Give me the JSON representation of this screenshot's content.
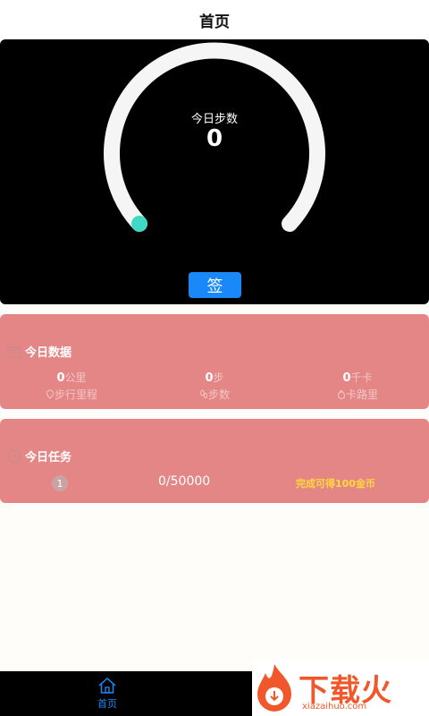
{
  "header": {
    "title": "首页"
  },
  "gauge": {
    "label": "今日步数",
    "value": "0",
    "progress": 0,
    "track_color": "#f5f5f5",
    "dot_color": "#3fd9c4"
  },
  "sign_button": {
    "label": "签"
  },
  "today_data": {
    "title": "今日数据",
    "icon": "calendar-icon",
    "stats": [
      {
        "value": "0",
        "unit": "公里",
        "label": "步行里程",
        "icon": "location-icon"
      },
      {
        "value": "0",
        "unit": "步",
        "label": "步数",
        "icon": "footprint-icon"
      },
      {
        "value": "0",
        "unit": "千卡",
        "label": "卡路里",
        "icon": "fire-icon"
      }
    ]
  },
  "today_task": {
    "title": "今日任务",
    "icon": "clock-icon",
    "badge": "1",
    "progress_text": "0/50000",
    "reward": "完成可得100金币"
  },
  "tabbar": {
    "home_label": "首页",
    "home_icon": "home-icon",
    "active_color": "#1989fa"
  },
  "watermark": {
    "text": "下载火",
    "sub": "xiazaihuo.com"
  }
}
